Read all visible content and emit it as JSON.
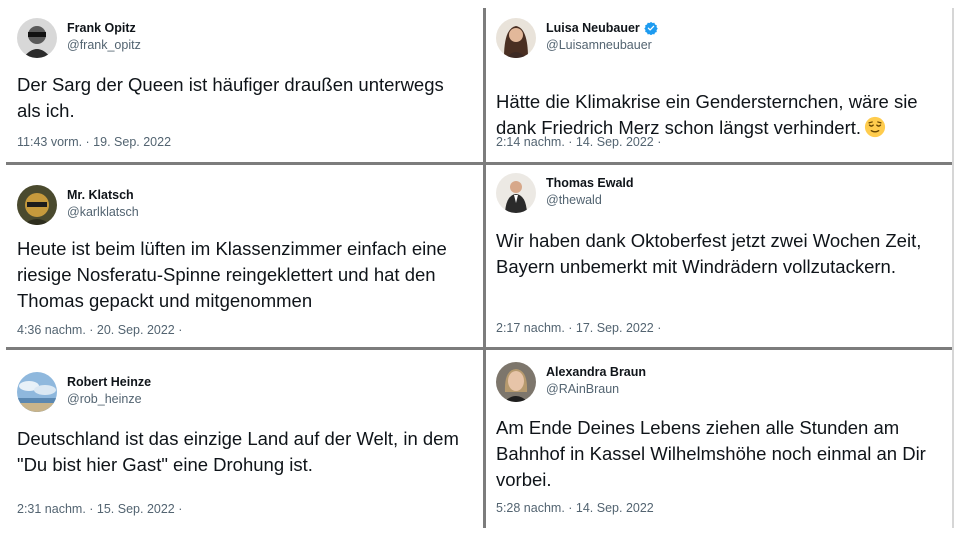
{
  "tweets": [
    {
      "name": "Frank Opitz",
      "handle": "@frank_opitz",
      "text": "Der Sarg der Queen ist häufiger draußen unterwegs\nals  ich.",
      "meta": "11:43 vorm. · 19. Sep. 2022",
      "verified": false
    },
    {
      "name": "Luisa Neubauer",
      "handle": "@Luisamneubauer",
      "text": "Hätte die Klimakrise ein Gendersternchen, wäre sie\ndank Friedrich Merz schon längst verhindert.",
      "emoji": "relieved-face",
      "meta": "2:14 nachm. · 14. Sep. 2022 ·",
      "verified": true,
      "verified_color": "#1d9bf0"
    },
    {
      "name": "Mr. Klatsch",
      "handle": "@karlklatsch",
      "text": "Heute ist beim lüften im Klassenzimmer einfach eine\nriesige Nosferatu-Spinne reingeklettert und hat den\nThomas gepackt und mitgenommen",
      "meta": "4:36 nachm. · 20. Sep. 2022 ·",
      "verified": false
    },
    {
      "name": "Thomas Ewald",
      "handle": "@thewald",
      "text": "Wir haben dank Oktoberfest jetzt zwei Wochen Zeit,\nBayern unbemerkt mit Windrädern vollzutackern.",
      "meta": "2:17 nachm. · 17. Sep. 2022 ·",
      "verified": false
    },
    {
      "name": "Robert Heinze",
      "handle": "@rob_heinze",
      "text": "Deutschland ist das einzige Land auf der Welt, in dem\n\"Du bist hier Gast\" eine Drohung ist.",
      "meta": "2:31 nachm. · 15. Sep. 2022 ·",
      "verified": false
    },
    {
      "name": "Alexandra Braun",
      "handle": "@RAinBraun",
      "text": "Am Ende Deines Lebens ziehen alle Stunden am\nBahnhof in Kassel Wilhelmshöhe noch einmal an Dir\nvorbei.",
      "meta": "5:28 nachm. · 14. Sep. 2022",
      "verified": false
    }
  ],
  "colors": {
    "text": "#0f1419",
    "secondary": "#536471",
    "divider": "#7c7c7c",
    "verified": "#1d9bf0"
  }
}
